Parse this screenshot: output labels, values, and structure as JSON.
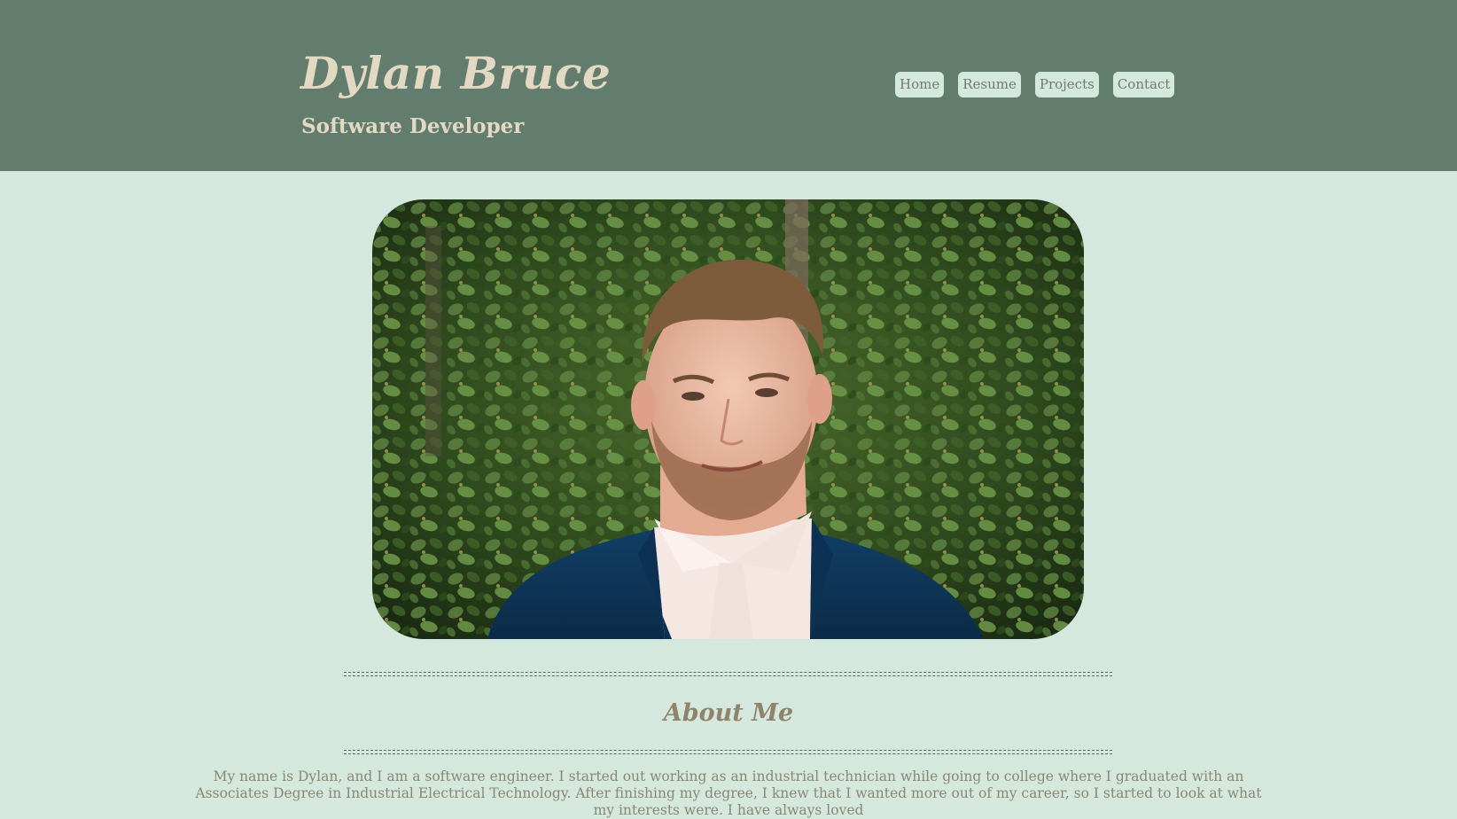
{
  "header": {
    "name": "Dylan Bruce",
    "subtitle": "Software Developer",
    "nav": [
      {
        "label": "Home"
      },
      {
        "label": "Resume"
      },
      {
        "label": "Projects"
      },
      {
        "label": "Contact"
      }
    ]
  },
  "hero": {
    "photo_icon": "profile-photo"
  },
  "about": {
    "heading": "About Me",
    "body": "My name is Dylan, and I am a software engineer. I started out working as an industrial technician while going to college where I graduated with an Associates Degree in Industrial Electrical Technology. After finishing my degree, I knew that I wanted more out of my career, so I started to look at what my interests were. I have always loved"
  },
  "colors": {
    "header_bg": "#627d6e",
    "page_bg": "#d5e8dd",
    "title_text": "#e3d8c2",
    "heading_text": "#8f836b"
  }
}
